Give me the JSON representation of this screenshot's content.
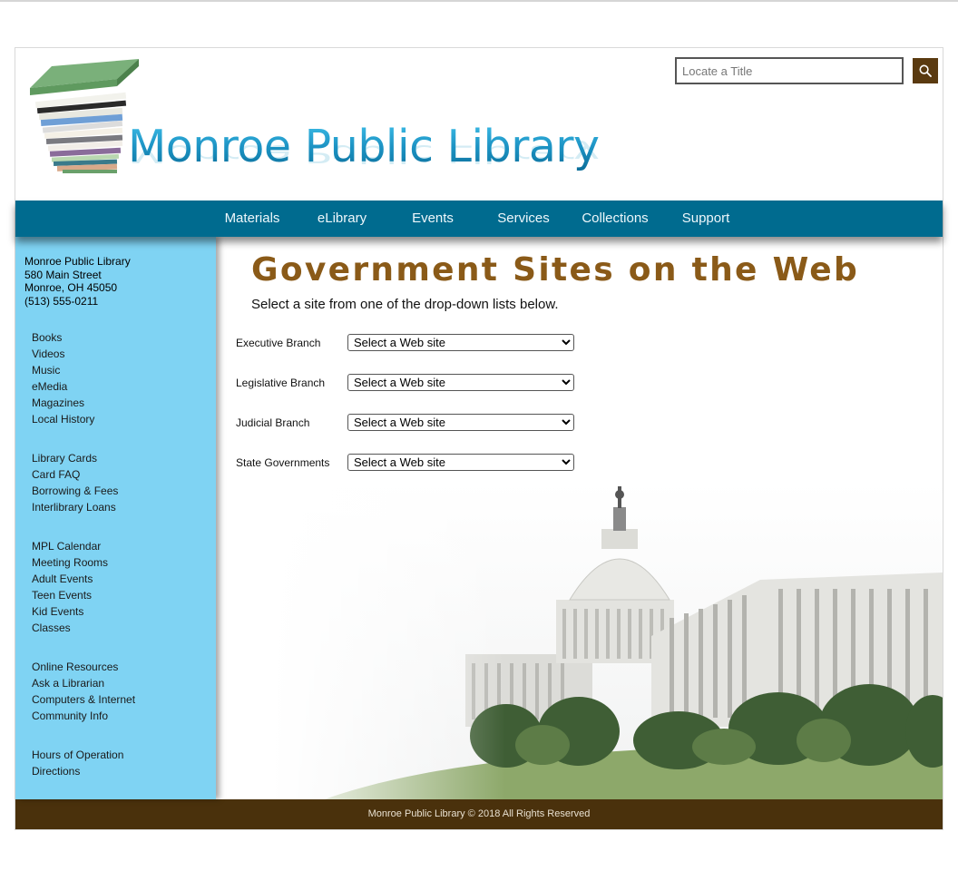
{
  "header": {
    "title": "Monroe Public Library",
    "search": {
      "placeholder": "Locate a Title",
      "value": ""
    },
    "search_icon": "search-icon",
    "logo_icon": "book-stack-icon"
  },
  "nav": {
    "items": [
      {
        "label": "Materials"
      },
      {
        "label": "eLibrary"
      },
      {
        "label": "Events"
      },
      {
        "label": "Services"
      },
      {
        "label": "Collections"
      },
      {
        "label": "Support"
      }
    ]
  },
  "sidebar": {
    "address": {
      "name": "Monroe Public Library",
      "street": "580 Main Street",
      "city": "Monroe, OH 45050",
      "phone": "(513) 555-0211"
    },
    "groups": [
      {
        "links": [
          "Books",
          "Videos",
          "Music",
          "eMedia",
          "Magazines",
          "Local History"
        ]
      },
      {
        "links": [
          "Library Cards",
          "Card FAQ",
          "Borrowing & Fees",
          "Interlibrary Loans"
        ]
      },
      {
        "links": [
          "MPL Calendar",
          "Meeting Rooms",
          "Adult Events",
          "Teen Events",
          "Kid Events",
          "Classes"
        ]
      },
      {
        "links": [
          "Online Resources",
          "Ask a Librarian",
          "Computers & Internet",
          "Community Info"
        ]
      },
      {
        "links": [
          "Hours of Operation",
          "Directions"
        ]
      }
    ]
  },
  "main": {
    "title": "Government Sites on the Web",
    "subtitle": "Select a site from one of the drop-down lists below.",
    "rows": [
      {
        "label": "Executive Branch",
        "selected": "Select a Web site"
      },
      {
        "label": "Legislative Branch",
        "selected": "Select a Web site"
      },
      {
        "label": "Judicial Branch",
        "selected": "Select a Web site"
      },
      {
        "label": "State Governments",
        "selected": "Select a Web site"
      }
    ]
  },
  "footer": {
    "text": "Monroe Public Library © 2018 All Rights Reserved"
  },
  "colors": {
    "nav": "#006b8f",
    "sidebar": "#7fd3f3",
    "footer": "#4a310c",
    "title": "#8a5a18",
    "search_button": "#5a3a10",
    "logo_text": "#1a9ac8"
  }
}
